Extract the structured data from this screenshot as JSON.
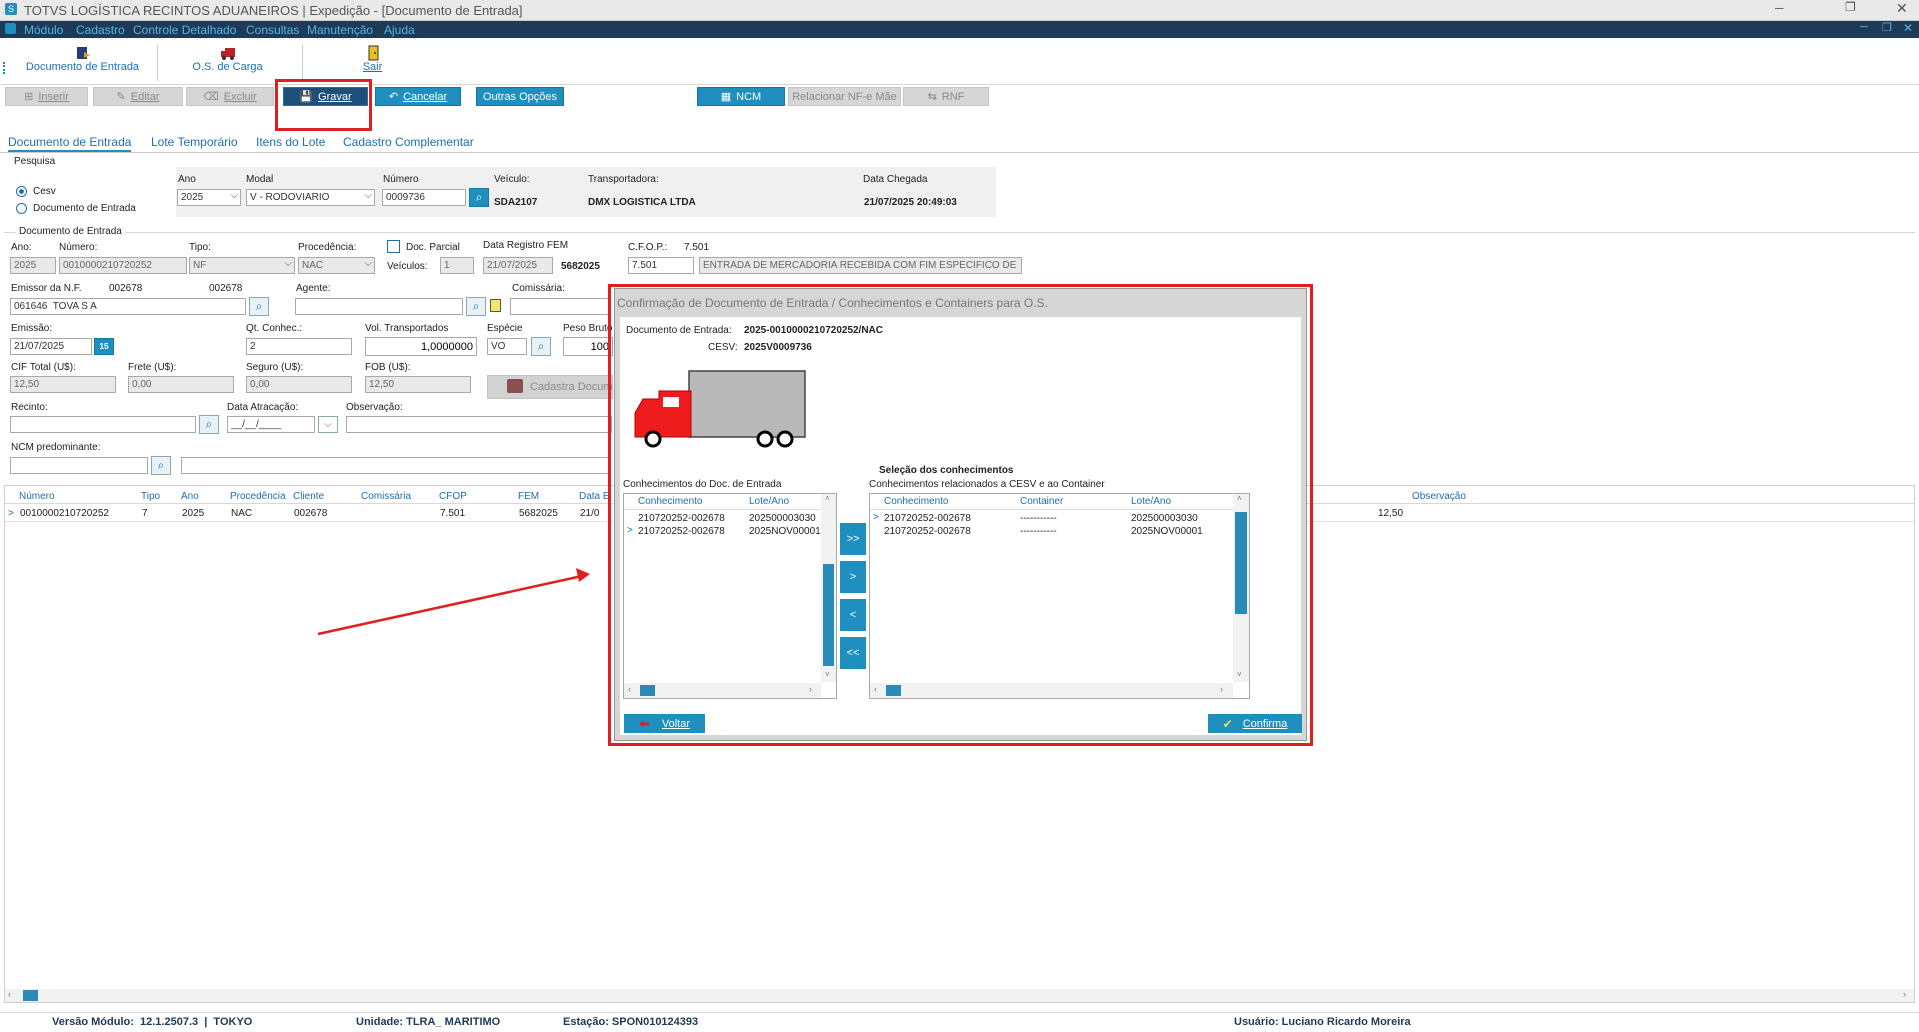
{
  "window": {
    "title": "TOTVS LOGÍSTICA RECINTOS ADUANEIROS | Expedição - [Documento de Entrada]"
  },
  "menu": {
    "items": [
      "Módulo",
      "Cadastro",
      "Controle Detalhado",
      "Consultas",
      "Manutenção",
      "Ajuda"
    ]
  },
  "shortcuts": {
    "doc_entrada": "Documento de Entrada",
    "os_carga": "O.S. de Carga",
    "sair": "Sair"
  },
  "toolbar": {
    "inserir": "Inserir",
    "editar": "Editar",
    "excluir": "Excluir",
    "gravar": "Gravar",
    "cancelar": "Cancelar",
    "outras": "Outras Opções",
    "ncm": "NCM",
    "relacionar": "Relacionar NF-e Mãe",
    "rnf": "RNF"
  },
  "tabs": [
    "Documento de Entrada",
    "Lote Temporário",
    "Itens do Lote",
    "Cadastro Complementar"
  ],
  "pesquisa": {
    "title": "Pesquisa",
    "radio_cesv": "Cesv",
    "radio_doc": "Documento de Entrada",
    "ano_label": "Ano",
    "ano": "2025",
    "modal_label": "Modal",
    "modal": "V - RODOVIARIO",
    "numero_label": "Número",
    "numero": "0009736",
    "veiculo_label": "Veículo:",
    "veiculo": "SDA2107",
    "transp_label": "Transportadora:",
    "transp": "DMX LOGISTICA LTDA",
    "data_label": "Data Chegada",
    "data": "21/07/2025 20:49:03"
  },
  "doc": {
    "title": "Documento de Entrada",
    "ano_label": "Ano:",
    "ano": "2025",
    "numero_label": "Número:",
    "numero": "0010000210720252",
    "tipo_label": "Tipo:",
    "tipo": "NF",
    "proc_label": "Procedência:",
    "proc": "NAC",
    "parcial_label": "Doc. Parcial",
    "veiculos_label": "Veículos:",
    "veiculos": "1",
    "datafem_label": "Data Registro FEM",
    "datafem": "21/07/2025",
    "fem": "5682025",
    "cfop_label": "C.F.O.P.:",
    "cfop_top": "7.501",
    "cfop": "7.501",
    "cfop_desc": "ENTRADA DE MERCADORIA RECEBIDA COM FIM ESPECÍFICO DE",
    "emissor_label": "Emissor da N.F.",
    "emissor_code1": "002678",
    "emissor_code2": "002678",
    "emissor": "061646  TOVA S A",
    "agente_label": "Agente:",
    "comissaria_label": "Comissária:",
    "emissao_label": "Emissão:",
    "emissao": "21/07/2025",
    "qt_label": "Qt. Conhec.:",
    "qt": "2",
    "vol_label": "Vol. Transportados",
    "vol": "1,0000000",
    "especie_label": "Espécie",
    "especie": "VO",
    "peso_label": "Peso Bruto",
    "peso": "100",
    "cif_label": "CIF Total (U$):",
    "cif": "12,50",
    "frete_label": "Frete (U$):",
    "frete": "0,00",
    "seguro_label": "Seguro (U$):",
    "seguro": "0,00",
    "fob_label": "FOB (U$):",
    "fob": "12,50",
    "cadastra": "Cadastra Docum",
    "recinto_label": "Recinto:",
    "atracacao_label": "Data Atracação:",
    "atracacao": "__/__/____",
    "obs_label": "Observação:",
    "ncm_label": "NCM predominante:"
  },
  "grid": {
    "headers": [
      "Número",
      "Tipo",
      "Ano",
      "Procedência",
      "Cliente",
      "Comissária",
      "CFOP",
      "FEM",
      "Data E",
      "Observação"
    ],
    "row": {
      "numero": "0010000210720252",
      "tipo": "7",
      "ano": "2025",
      "proc": "NAC",
      "cliente": "002678",
      "cfop": "7.501",
      "fem": "5682025",
      "data": "21/0",
      "valor": "12,50"
    }
  },
  "dialog": {
    "title": "Confirmação de Documento de Entrada / Conhecimentos  e Containers para O.S.",
    "doc_label": "Documento de Entrada:",
    "doc_value": "2025-0010000210720252/NAC",
    "cesv_label": "CESV:",
    "cesv_value": "2025V0009736",
    "selecao": "Seleção dos conhecimentos",
    "left_title": "Conhecimentos do Doc. de Entrada",
    "left_headers": [
      "Conhecimento",
      "Lote/Ano"
    ],
    "left_rows": [
      [
        "210720252-002678",
        "202500003030"
      ],
      [
        "210720252-002678",
        "2025NOV00001"
      ]
    ],
    "right_title": "Conhecimentos relacionados a CESV e ao Container",
    "right_headers": [
      "Conhecimento",
      "Container",
      "Lote/Ano"
    ],
    "right_rows": [
      [
        "210720252-002678",
        "-----------",
        "202500003030"
      ],
      [
        "210720252-002678",
        "-----------",
        "2025NOV00001"
      ]
    ],
    "btn_all_right": ">>",
    "btn_right": ">",
    "btn_left": "<",
    "btn_all_left": "<<",
    "voltar": "Voltar",
    "confirma": "Confirma"
  },
  "status": {
    "versao": "Versão Módulo:  12.1.2507.3  |  TOKYO",
    "unidade": "Unidade: TLRA_ MARITIMO",
    "estacao": "Estação: SPON010124393",
    "usuario": "Usuário: Luciano Ricardo Moreira"
  },
  "colors": {
    "accent": "#1f8fc0",
    "highlight": "#e02020",
    "titlebar": "#1d3a57"
  }
}
